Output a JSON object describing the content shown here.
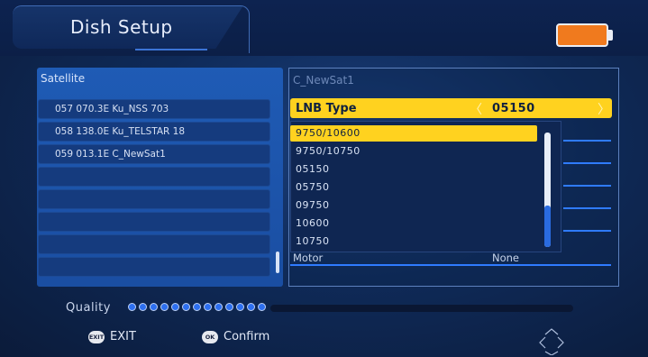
{
  "header": {
    "title": "Dish Setup",
    "battery_color": "#f07a1e"
  },
  "satellite_panel": {
    "header": "Satellite",
    "rows": [
      "057 070.3E Ku_NSS 703",
      "058 138.0E Ku_TELSTAR 18",
      "059 013.1E C_NewSat1",
      "",
      "",
      "",
      "",
      ""
    ]
  },
  "config_panel": {
    "satellite_name": "C_NewSat1",
    "lnb_type": {
      "label": "LNB Type",
      "value": "05150",
      "left_arrow": "〈",
      "right_arrow": "〉"
    },
    "lnb_options": [
      "9750/10600",
      "9750/10750",
      "05150",
      "05750",
      "09750",
      "10600",
      "10750"
    ],
    "selected_option_index": 0,
    "motor": {
      "label": "Motor",
      "value": "None"
    }
  },
  "quality": {
    "label": "Quality",
    "level_dots": 13
  },
  "footer": {
    "exit_key": "EXIT",
    "exit_label": "EXIT",
    "ok_key": "OK",
    "confirm_label": "Confirm"
  },
  "colors": {
    "highlight": "#ffd21f",
    "accent": "#2f7bff",
    "panel": "#1f5bb5"
  }
}
